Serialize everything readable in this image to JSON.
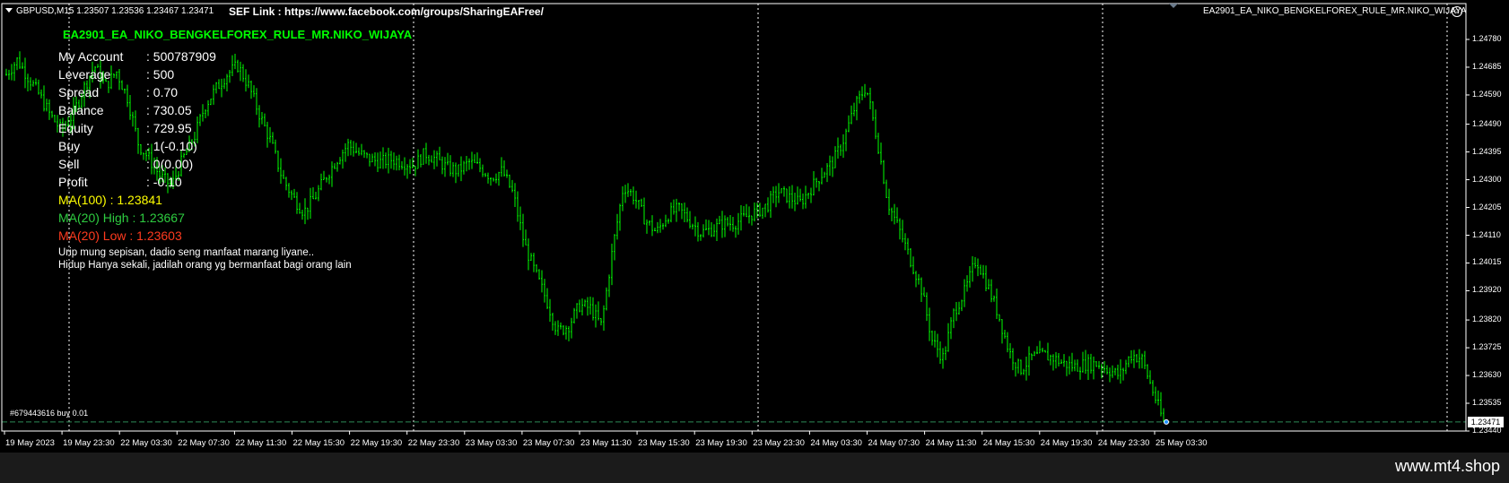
{
  "header": {
    "symbol_info": "GBPUSD,M15  1.23507 1.23536 1.23467 1.23471",
    "link": "SEF Link : https://www.facebook.com/groups/SharingEAFree/",
    "ea_name": "EA2901_EA_NIKO_BENGKELFOREX_RULE_MR.NIKO_WIJAYA"
  },
  "panel": {
    "title": "EA2901_EA_NIKO_BENGKELFOREX_RULE_MR.NIKO_WIJAYA",
    "rows": [
      {
        "label": "My Account",
        "value": ": 500787909",
        "color": "#ffffff"
      },
      {
        "label": "Leverage",
        "value": ": 500",
        "color": "#ffffff"
      },
      {
        "label": "Spread",
        "value": ": 0.70",
        "color": "#ffffff"
      },
      {
        "label": "Balance",
        "value": ": 730.05",
        "color": "#ffffff"
      },
      {
        "label": "Equity",
        "value": ": 729.95",
        "color": "#ffffff"
      },
      {
        "label": "Buy",
        "value": ": 1(-0.10)",
        "color": "#ffffff"
      },
      {
        "label": "Sell",
        "value": ": 0(0.00)",
        "color": "#ffffff"
      },
      {
        "label": "Profit",
        "value": ": -0.10",
        "color": "#ffffff"
      }
    ],
    "ma_lines": [
      {
        "text": "MA(100) : 1.23841",
        "color": "#ffff00"
      },
      {
        "text": "MA(20) High : 1.23667",
        "color": "#2ecc40"
      },
      {
        "text": "MA(20) Low : 1.23603",
        "color": "#ff3b1f"
      }
    ],
    "quote_1": "Urip mung sepisan, dadio seng manfaat marang liyane..",
    "quote_2": "Hidup Hanya sekali, jadilah orang yg bermanfaat bagi orang lain"
  },
  "order_label": "#679443616 buy 0.01",
  "current_price": "1.23471",
  "watermark": "www.mt4.shop",
  "colors": {
    "candle": "#00ff00",
    "grid": "#ffffff",
    "bid_line": "#2e8b57"
  },
  "chart_data": {
    "type": "candlestick",
    "symbol": "GBPUSD",
    "timeframe": "M15",
    "y_ticks": [
      "1.24780",
      "1.24685",
      "1.24590",
      "1.24490",
      "1.24395",
      "1.24300",
      "1.24205",
      "1.24110",
      "1.24015",
      "1.23920",
      "1.23820",
      "1.23725",
      "1.23630",
      "1.23535",
      "1.23440"
    ],
    "ylim": [
      1.2344,
      1.2478
    ],
    "x_ticks": [
      "19 May 2023",
      "19 May 23:30",
      "22 May 03:30",
      "22 May 07:30",
      "22 May 11:30",
      "22 May 15:30",
      "22 May 19:30",
      "22 May 23:30",
      "23 May 03:30",
      "23 May 07:30",
      "23 May 11:30",
      "23 May 15:30",
      "23 May 19:30",
      "23 May 23:30",
      "24 May 03:30",
      "24 May 07:30",
      "24 May 11:30",
      "24 May 15:30",
      "24 May 19:30",
      "24 May 23:30",
      "25 May 03:30"
    ],
    "close_path": [
      1.2466,
      1.2471,
      1.2465,
      1.2459,
      1.2452,
      1.2447,
      1.2452,
      1.2461,
      1.2469,
      1.2462,
      1.2467,
      1.2458,
      1.2442,
      1.2437,
      1.2431,
      1.2428,
      1.2437,
      1.2444,
      1.2455,
      1.2461,
      1.2466,
      1.2469,
      1.2462,
      1.2452,
      1.2443,
      1.2431,
      1.2424,
      1.2419,
      1.2424,
      1.2431,
      1.2437,
      1.2442,
      1.2439,
      1.2437,
      1.2436,
      1.2437,
      1.2436,
      1.2435,
      1.2439,
      1.2437,
      1.2434,
      1.2433,
      1.2436,
      1.2434,
      1.2431,
      1.2433,
      1.2425,
      1.2408,
      1.2398,
      1.2389,
      1.2378,
      1.238,
      1.2387,
      1.2386,
      1.238,
      1.2406,
      1.2428,
      1.2424,
      1.2416,
      1.2412,
      1.2418,
      1.242,
      1.2416,
      1.2412,
      1.2413,
      1.2415,
      1.2415,
      1.2417,
      1.2419,
      1.2421,
      1.2426,
      1.2424,
      1.2422,
      1.2427,
      1.2432,
      1.2436,
      1.2444,
      1.2455,
      1.2462,
      1.2444,
      1.2422,
      1.2413,
      1.2403,
      1.2393,
      1.2375,
      1.2369,
      1.2385,
      1.2392,
      1.2403,
      1.2394,
      1.2384,
      1.2371,
      1.2365,
      1.2369,
      1.237,
      1.2369,
      1.2367,
      1.2366,
      1.2367,
      1.2367,
      1.2365,
      1.2363,
      1.237,
      1.2369,
      1.2358,
      1.2347
    ],
    "last_price": 1.23471,
    "ma_100": 1.23841,
    "ma_20_high": 1.23667,
    "ma_20_low": 1.23603
  }
}
